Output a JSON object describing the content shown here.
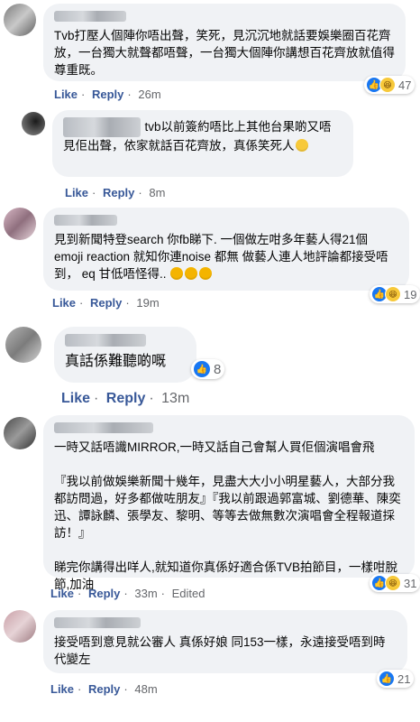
{
  "comments": [
    {
      "text": "Tvb打壓人個陣你唔出聲，笑死，見沉沉地就話要娛樂圈百花齊放，一台獨大就聲都唔聲，一台獨大個陣你講想百花齊放就值得尊重既。",
      "like": "Like",
      "reply": "Reply",
      "time": "26m",
      "count": "47"
    },
    {
      "text": "tvb以前簽約唔比上其他台果啲又唔見佢出聲，依家就話百花齊放，真係笑死人",
      "like": "Like",
      "reply": "Reply",
      "time": "8m"
    },
    {
      "text": "見到新聞特登search 你fb睇下. 一個做左咁多年藝人得21個 emoji reaction 就知你連noise 都無 做藝人連人地評論都接受唔到， eq 甘低唔怪得..",
      "like": "Like",
      "reply": "Reply",
      "time": "19m",
      "count": "19"
    },
    {
      "text": "真話係難聽啲嘅",
      "like": "Like",
      "reply": "Reply",
      "time": "13m",
      "count": "8"
    },
    {
      "text": "一時又話唔識MIRROR,一時又話自己會幫人買佢個演唱會飛\n\n『我以前做娛樂新聞十幾年，見盡大大小小明星藝人，大部分我都訪問過，好多都做咗朋友』『我以前跟過郭富城、劉德華、陳奕迅、譚詠麟、張學友、黎明、等等去做無數次演唱會全程報道採訪！』\n\n睇完你講得出咩人,就知道你真係好適合係TVB拍節目，一樣咁脫節,加油",
      "like": "Like",
      "reply": "Reply",
      "time": "33m",
      "edited": "Edited",
      "count": "31"
    },
    {
      "text": "接受唔到意見就公審人 真係好娘 同153一樣，永遠接受唔到時代變左",
      "like": "Like",
      "reply": "Reply",
      "time": "48m",
      "count": "21"
    }
  ],
  "separator": "·",
  "icons": {
    "like": "thumbs-up-icon",
    "haha": "laughing-face-icon",
    "wow": "surprised-face-icon"
  },
  "colors": {
    "link": "#385898",
    "bubble": "#f0f2f5",
    "like_blue": "#1877f2"
  }
}
